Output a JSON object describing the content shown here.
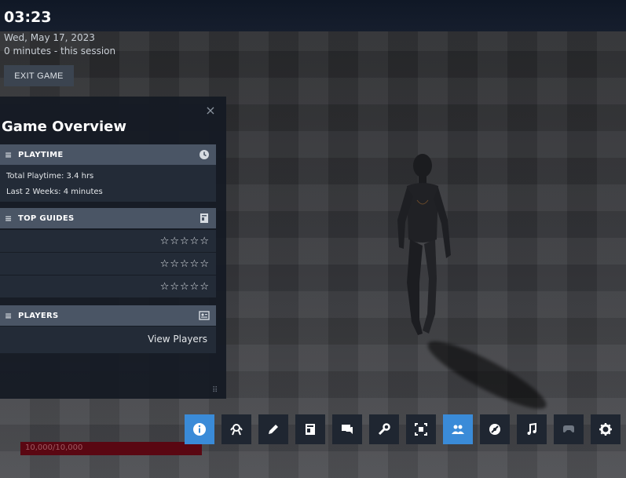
{
  "overlay": {
    "time": "03:23",
    "date": "Wed, May 17, 2023",
    "session": "0 minutes - this session",
    "exit_label": "EXIT GAME"
  },
  "panel": {
    "title": "Game Overview",
    "close_glyph": "×",
    "playtime": {
      "header": "PLAYTIME",
      "icon": "clock-icon",
      "total": "Total Playtime: 3.4 hrs",
      "recent": "Last 2 Weeks: 4 minutes"
    },
    "guides": {
      "header": "TOP GUIDES",
      "icon": "guide-book-icon",
      "rows": [
        {
          "stars": "☆☆☆☆☆"
        },
        {
          "stars": "☆☆☆☆☆"
        },
        {
          "stars": "☆☆☆☆☆"
        }
      ]
    },
    "players": {
      "header": "PLAYERS",
      "icon": "players-card-icon",
      "link": "View Players"
    }
  },
  "health": {
    "text": "10,000/10,000",
    "fraction": 1.0
  },
  "toolbar": {
    "items": [
      {
        "name": "info-icon",
        "active": true
      },
      {
        "name": "achievements-icon",
        "active": false
      },
      {
        "name": "notes-pencil-icon",
        "active": false
      },
      {
        "name": "guides-book-icon",
        "active": false
      },
      {
        "name": "chat-icon",
        "active": false
      },
      {
        "name": "wrench-icon",
        "active": false
      },
      {
        "name": "screenshot-icon",
        "active": false
      },
      {
        "name": "friends-icon",
        "active": true
      },
      {
        "name": "browser-icon",
        "active": false
      },
      {
        "name": "music-icon",
        "active": false
      },
      {
        "name": "controller-icon",
        "active": false
      },
      {
        "name": "settings-gear-icon",
        "active": false
      }
    ]
  },
  "colors": {
    "accent": "#3a8bd8",
    "panel": "#141a24",
    "section_header": "#4a5565",
    "health": "#5a0712"
  }
}
